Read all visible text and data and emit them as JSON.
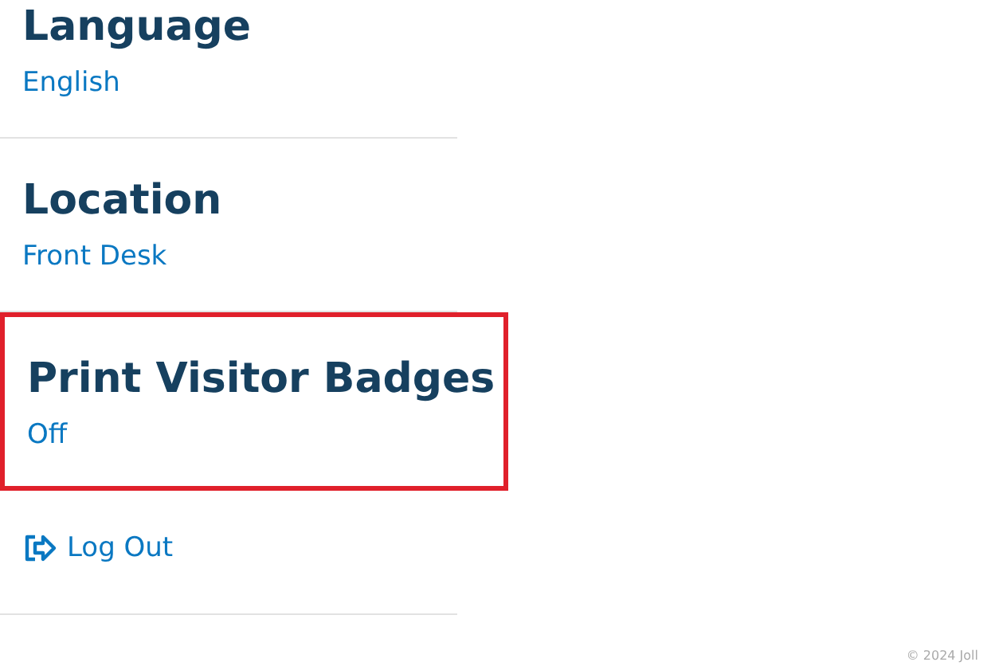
{
  "settings": [
    {
      "title": "Language",
      "value": "English",
      "highlighted": false
    },
    {
      "title": "Location",
      "value": "Front Desk",
      "highlighted": false
    },
    {
      "title": "Print Visitor Badges",
      "value": "Off",
      "highlighted": true
    }
  ],
  "logout": {
    "label": "Log Out"
  },
  "footer": {
    "copyright": "© 2024 Joll"
  }
}
